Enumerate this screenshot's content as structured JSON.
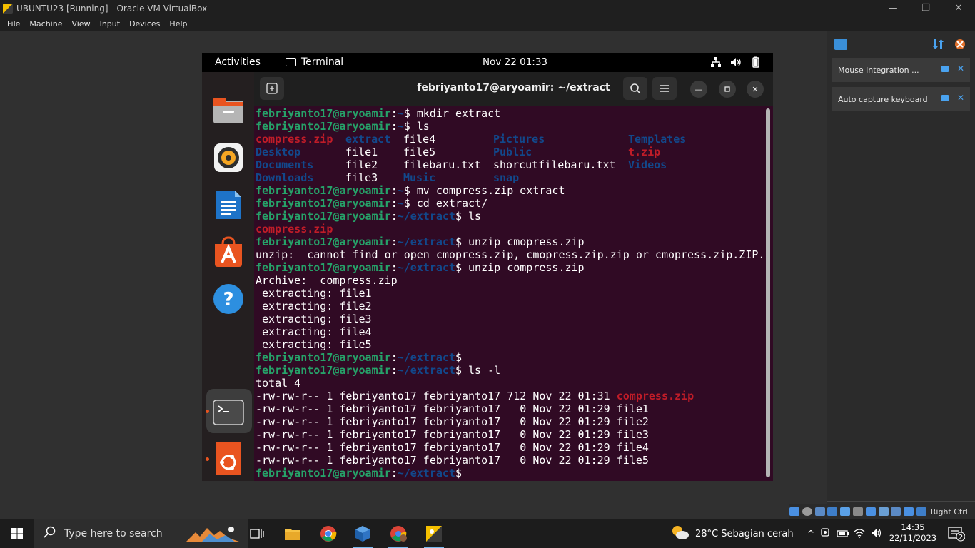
{
  "host_window": {
    "title": "UBUNTU23 [Running] - Oracle VM VirtualBox",
    "menu": [
      "File",
      "Machine",
      "View",
      "Input",
      "Devices",
      "Help"
    ],
    "status_right": "Right Ctrl"
  },
  "notifications": [
    {
      "text": "Mouse integration ..."
    },
    {
      "text": "Auto capture keyboard ..."
    }
  ],
  "gnome": {
    "activities": "Activities",
    "app_name": "Terminal",
    "clock": "Nov 22  01:33"
  },
  "terminal": {
    "title": "febriyanto17@aryoamir: ~/extract",
    "user_host": "febriyanto17@aryoamir",
    "lines": [
      {
        "path": "~",
        "cmd": " mkdir extract"
      },
      {
        "path": "~",
        "cmd": " ls"
      }
    ],
    "ls_grid": [
      [
        {
          "t": "compress.zip",
          "c": "z"
        },
        {
          "t": "extract",
          "c": "d"
        },
        {
          "t": "file4",
          "c": ""
        },
        {
          "t": "Pictures",
          "c": "d"
        },
        {
          "t": "Templates",
          "c": "d"
        }
      ],
      [
        {
          "t": "Desktop",
          "c": "d"
        },
        {
          "t": "file1",
          "c": ""
        },
        {
          "t": "file5",
          "c": ""
        },
        {
          "t": "Public",
          "c": "d"
        },
        {
          "t": "t.zip",
          "c": "z"
        }
      ],
      [
        {
          "t": "Documents",
          "c": "d"
        },
        {
          "t": "file2",
          "c": ""
        },
        {
          "t": "filebaru.txt",
          "c": ""
        },
        {
          "t": "shorcutfilebaru.txt",
          "c": ""
        },
        {
          "t": "Videos",
          "c": "d"
        }
      ],
      [
        {
          "t": "Downloads",
          "c": "d"
        },
        {
          "t": "file3",
          "c": ""
        },
        {
          "t": "Music",
          "c": "d"
        },
        {
          "t": "snap",
          "c": "d"
        },
        {
          "t": "",
          "c": ""
        }
      ]
    ],
    "after": [
      {
        "type": "prompt",
        "path": "~",
        "cmd": " mv compress.zip extract"
      },
      {
        "type": "prompt",
        "path": "~",
        "cmd": " cd extract/"
      },
      {
        "type": "prompt",
        "path": "~/extract",
        "cmd": " ls"
      },
      {
        "type": "out",
        "text": "compress.zip",
        "cls": "z"
      },
      {
        "type": "prompt",
        "path": "~/extract",
        "cmd": " unzip cmopress.zip"
      },
      {
        "type": "out",
        "text": "unzip:  cannot find or open cmopress.zip, cmopress.zip.zip or cmopress.zip.ZIP.",
        "cls": ""
      },
      {
        "type": "prompt",
        "path": "~/extract",
        "cmd": " unzip compress.zip"
      },
      {
        "type": "out",
        "text": "Archive:  compress.zip",
        "cls": ""
      },
      {
        "type": "out",
        "text": " extracting: file1",
        "cls": ""
      },
      {
        "type": "out",
        "text": " extracting: file2",
        "cls": ""
      },
      {
        "type": "out",
        "text": " extracting: file3",
        "cls": ""
      },
      {
        "type": "out",
        "text": " extracting: file4",
        "cls": ""
      },
      {
        "type": "out",
        "text": " extracting: file5",
        "cls": ""
      },
      {
        "type": "prompt",
        "path": "~/extract",
        "cmd": ""
      },
      {
        "type": "prompt",
        "path": "~/extract",
        "cmd": " ls -l"
      },
      {
        "type": "out",
        "text": "total 4",
        "cls": ""
      },
      {
        "type": "lsl",
        "text": "-rw-rw-r-- 1 febriyanto17 febriyanto17 712 Nov 22 01:31 ",
        "name": "compress.zip",
        "cls": "z"
      },
      {
        "type": "lsl",
        "text": "-rw-rw-r-- 1 febriyanto17 febriyanto17   0 Nov 22 01:29 ",
        "name": "file1",
        "cls": ""
      },
      {
        "type": "lsl",
        "text": "-rw-rw-r-- 1 febriyanto17 febriyanto17   0 Nov 22 01:29 ",
        "name": "file2",
        "cls": ""
      },
      {
        "type": "lsl",
        "text": "-rw-rw-r-- 1 febriyanto17 febriyanto17   0 Nov 22 01:29 ",
        "name": "file3",
        "cls": ""
      },
      {
        "type": "lsl",
        "text": "-rw-rw-r-- 1 febriyanto17 febriyanto17   0 Nov 22 01:29 ",
        "name": "file4",
        "cls": ""
      },
      {
        "type": "lsl",
        "text": "-rw-rw-r-- 1 febriyanto17 febriyanto17   0 Nov 22 01:29 ",
        "name": "file5",
        "cls": ""
      },
      {
        "type": "prompt",
        "path": "~/extract",
        "cmd": ""
      }
    ]
  },
  "taskbar": {
    "search_placeholder": "Type here to search",
    "weather": "28°C  Sebagian cerah",
    "time": "14:35",
    "date": "22/11/2023",
    "notif_count": "2"
  },
  "colors": {
    "terminal_bg": "#300a24",
    "user_green": "#26a269",
    "path_blue": "#12488b",
    "zip_red": "#c01c28",
    "ubuntu_orange": "#e95420"
  }
}
